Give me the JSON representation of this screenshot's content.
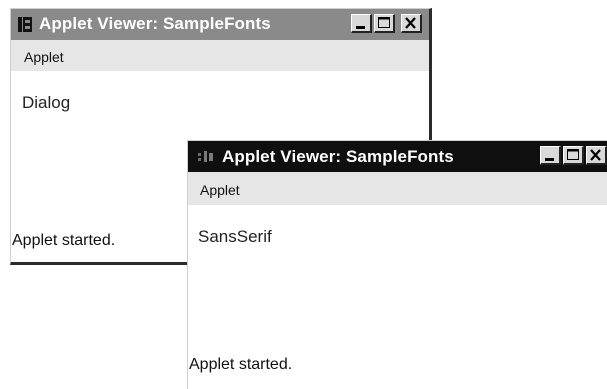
{
  "windows": [
    {
      "title": "Applet Viewer: SampleFonts",
      "menu": [
        "Applet"
      ],
      "font_label": "Dialog",
      "status": "Applet started.",
      "active": false
    },
    {
      "title": "Applet Viewer: SampleFonts",
      "menu": [
        "Applet"
      ],
      "font_label": "SansSerif",
      "status": "Applet started.",
      "active": true
    }
  ],
  "icons": {
    "app": "java-applet-icon",
    "minimize": "minimize-icon",
    "maximize": "maximize-icon",
    "close": "close-icon"
  },
  "colors": {
    "inactive_titlebar": "#8a8a8a",
    "active_titlebar": "#0f0f0f",
    "menubar": "#e6e6e6",
    "button_face": "#d9d9d9"
  }
}
